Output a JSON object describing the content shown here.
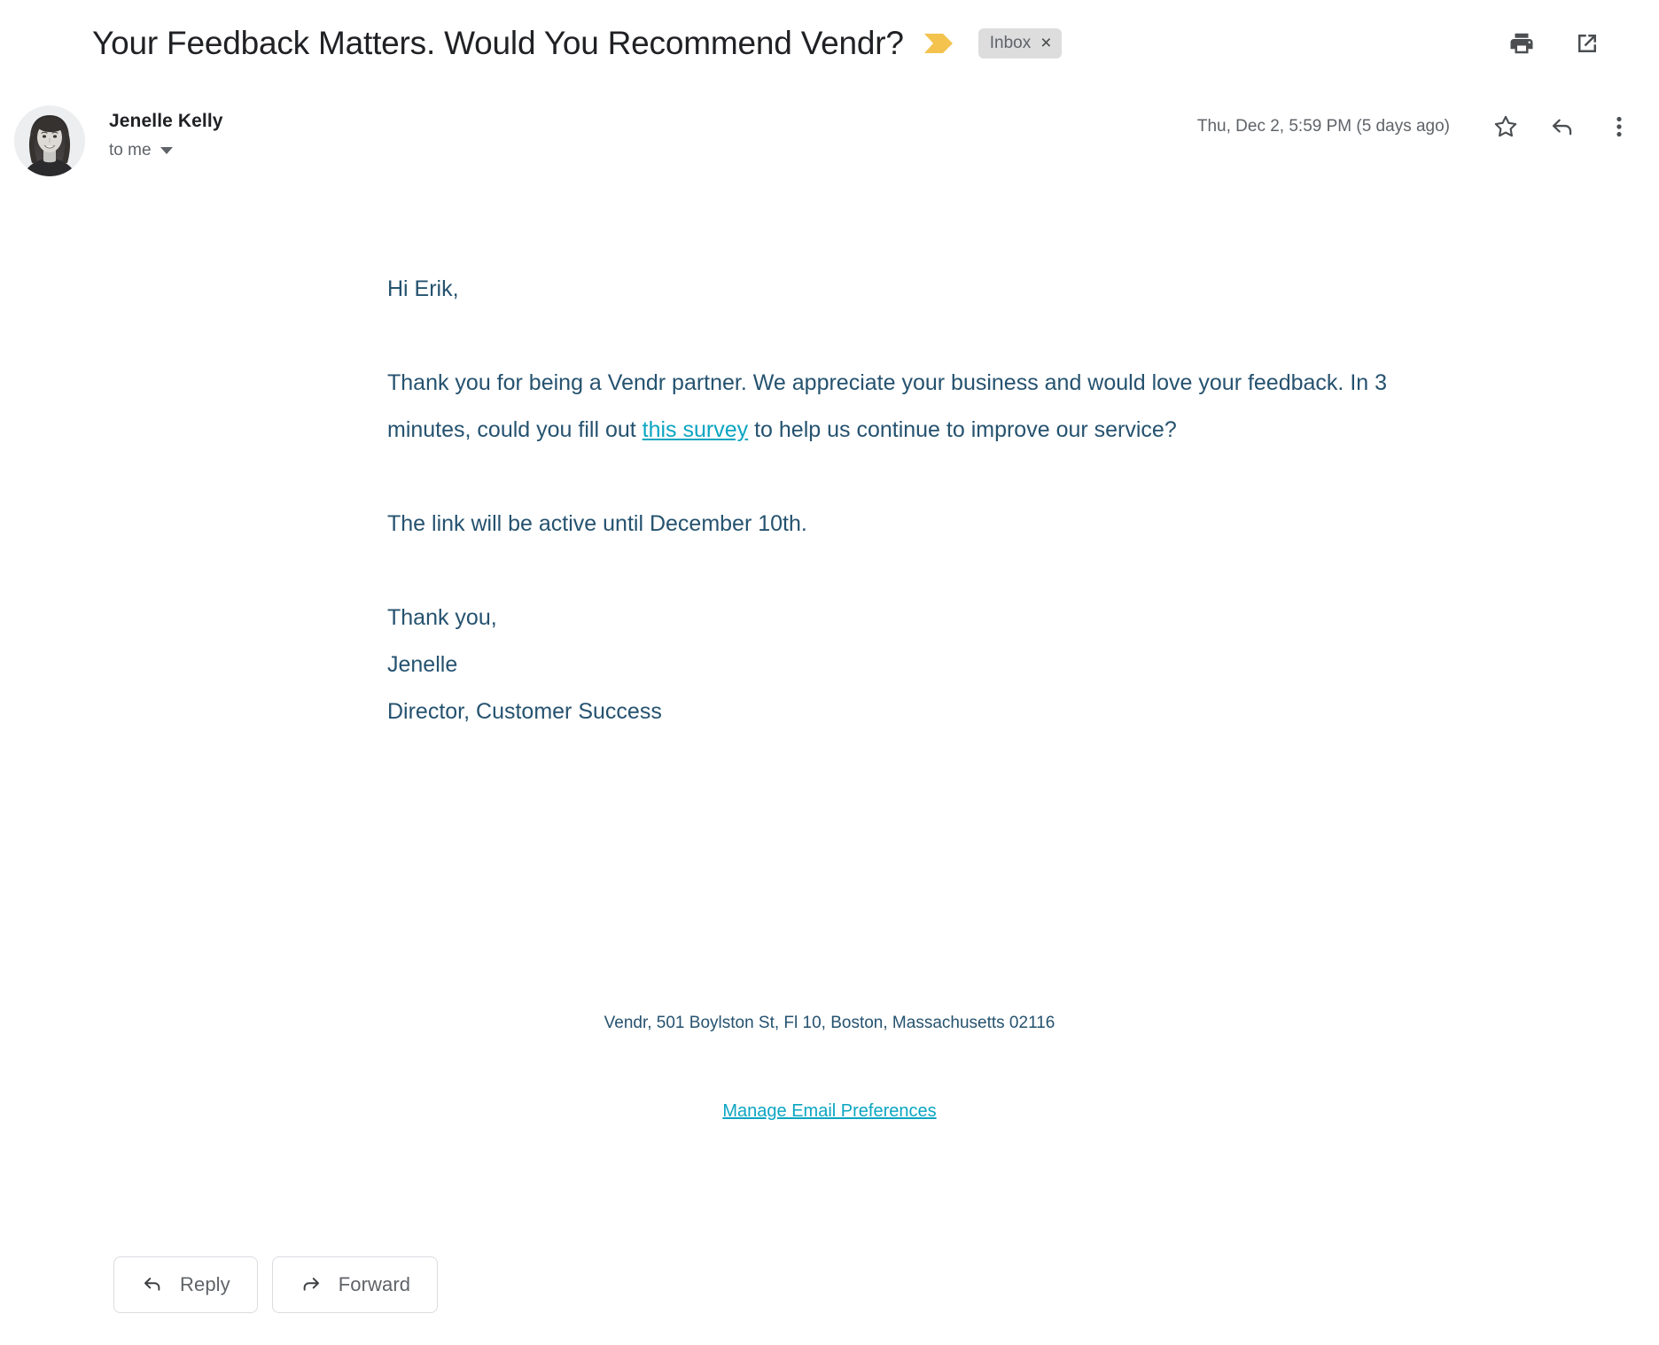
{
  "header": {
    "subject": "Your Feedback Matters. Would You Recommend Vendr?",
    "important_marker": "important-chevron",
    "label": {
      "text": "Inbox",
      "close_glyph": "×"
    },
    "actions": [
      {
        "name": "print-icon",
        "tooltip": "Print all"
      },
      {
        "name": "open-in-new-window-icon",
        "tooltip": "In new window"
      }
    ]
  },
  "message": {
    "sender_name": "Jenelle Kelly",
    "recipient": "to me",
    "timestamp": "Thu, Dec 2, 5:59 PM (5 days ago)",
    "actions": [
      {
        "name": "star-icon",
        "tooltip": "Star"
      },
      {
        "name": "reply-icon",
        "tooltip": "Reply"
      },
      {
        "name": "more-options-icon",
        "tooltip": "More"
      }
    ]
  },
  "body": {
    "greeting": "Hi Erik,",
    "paragraph_1_before_link": "Thank you for being a Vendr partner. We appreciate your business and would love your feedback. In 3 minutes, could you fill out ",
    "paragraph_1_link": "this survey",
    "paragraph_1_after_link": " to help us continue to improve our service?",
    "paragraph_2": "The link will be active until December 10th.",
    "signoff": "Thank you,",
    "signature_name": "Jenelle",
    "signature_title": "Director, Customer Success"
  },
  "footer": {
    "address": "Vendr, 501 Boylston St, Fl 10, Boston, Massachusetts 02116",
    "preferences_link": "Manage Email Preferences"
  },
  "action_bar": {
    "reply_label": "Reply",
    "forward_label": "Forward"
  },
  "colors": {
    "body_text": "#25526f",
    "link": "#0ba5c2",
    "important_marker": "#f3c34e",
    "label_pill_bg": "#ddddde",
    "subject_text": "#202124",
    "muted_text": "#5f6368",
    "icon": "#4b4f52",
    "button_border": "#dadce0"
  }
}
